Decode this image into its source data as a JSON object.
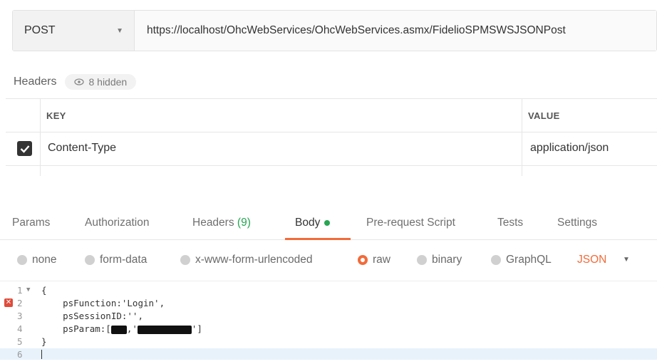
{
  "request": {
    "method": "POST",
    "url": "https://localhost/OhcWebServices/OhcWebServices.asmx/FidelioSPMSWSJSONPost"
  },
  "headers_section": {
    "title": "Headers",
    "hidden_label": "8 hidden",
    "columns": {
      "key": "KEY",
      "value": "VALUE"
    },
    "rows": [
      {
        "checked": true,
        "key": "Content-Type",
        "value": "application/json"
      }
    ]
  },
  "tabs": [
    {
      "label": "Params"
    },
    {
      "label": "Authorization"
    },
    {
      "label": "Headers",
      "count": "(9)"
    },
    {
      "label": "Body",
      "active": true
    },
    {
      "label": "Pre-request Script"
    },
    {
      "label": "Tests"
    },
    {
      "label": "Settings"
    }
  ],
  "body_types": {
    "options": [
      "none",
      "form-data",
      "x-www-form-urlencoded",
      "raw",
      "binary",
      "GraphQL"
    ],
    "selected": "raw",
    "format": "JSON"
  },
  "editor": {
    "lines": [
      {
        "n": "1",
        "text": "{"
      },
      {
        "n": "2",
        "text": "    psFunction:'Login',"
      },
      {
        "n": "3",
        "text": "    psSessionID:'',"
      },
      {
        "n": "4",
        "text_prefix": "    psParam:[",
        "text_mid": ",'",
        "text_suffix": "']"
      },
      {
        "n": "5",
        "text": "}"
      },
      {
        "n": "6",
        "text": ""
      }
    ]
  },
  "colors": {
    "accent": "#f26b3a",
    "green": "#26a651",
    "error": "#e04b3a"
  }
}
